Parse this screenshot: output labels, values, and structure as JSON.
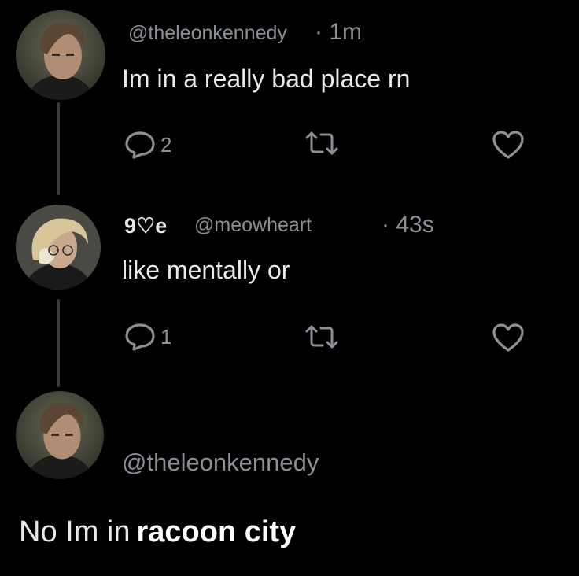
{
  "tweet1": {
    "handle": "@theleonkennedy",
    "time": "· 1m",
    "text": "Im in a really bad place rn",
    "reply_count": "2",
    "avatar_icon": "leon-avatar"
  },
  "tweet2": {
    "display_name": "9♡e",
    "handle": "@meowheart",
    "time": "· 43s",
    "text": "like mentally or",
    "reply_count": "1",
    "avatar_icon": "meowheart-avatar"
  },
  "tweet3": {
    "handle": "@theleonkennedy",
    "text_plain": "No Im in",
    "text_bold": "racoon city",
    "avatar_icon": "leon-avatar"
  },
  "icons": {
    "reply": "reply-bubble-icon",
    "retweet": "retweet-icon",
    "like": "heart-icon"
  },
  "colors": {
    "background": "#000000",
    "text_primary": "#e7e9ea",
    "text_secondary": "#8b9096",
    "thread_line": "#3a3d41"
  }
}
